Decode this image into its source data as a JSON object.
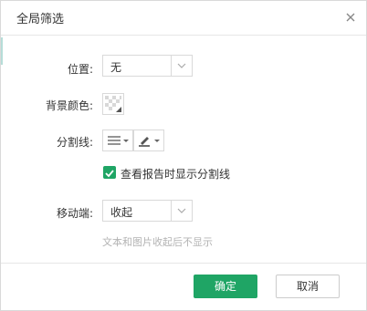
{
  "dialog": {
    "title": "全局筛选"
  },
  "position": {
    "label": "位置:",
    "value": "无"
  },
  "background": {
    "label": "背景颜色:"
  },
  "divider": {
    "label": "分割线:",
    "checkbox_label": "查看报告时显示分割线",
    "checked": true
  },
  "mobile": {
    "label": "移动端:",
    "value": "收起",
    "hint": "文本和图片收起后不显示"
  },
  "footer": {
    "ok_label": "确定",
    "cancel_label": "取消"
  },
  "colors": {
    "accent": "#1fa565",
    "border": "#d9d9d9",
    "hint": "#b3b3b3"
  }
}
